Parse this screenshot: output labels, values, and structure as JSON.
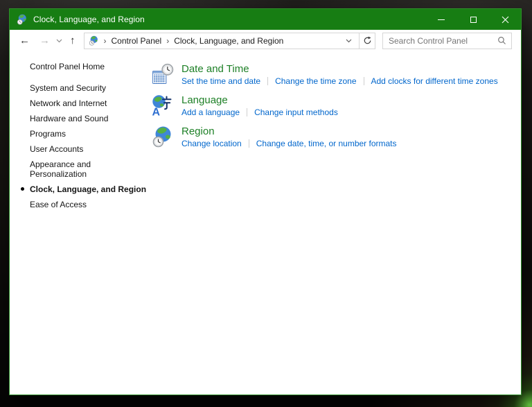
{
  "window": {
    "title": "Clock, Language, and Region"
  },
  "navbar": {
    "icons": {
      "back": "←",
      "forward": "→",
      "up": "↑"
    },
    "breadcrumb": {
      "separator": "›",
      "items": [
        "Control Panel",
        "Clock, Language, and Region"
      ]
    },
    "search": {
      "placeholder": "Search Control Panel"
    }
  },
  "sidebar": {
    "home": "Control Panel Home",
    "items": [
      {
        "label": "System and Security"
      },
      {
        "label": "Network and Internet"
      },
      {
        "label": "Hardware and Sound"
      },
      {
        "label": "Programs"
      },
      {
        "label": "User Accounts"
      },
      {
        "label": "Appearance and Personalization"
      },
      {
        "label": "Clock, Language, and Region",
        "active": true
      },
      {
        "label": "Ease of Access"
      }
    ]
  },
  "main": {
    "sections": [
      {
        "icon": "date-and-time-icon",
        "title": "Date and Time",
        "links": [
          "Set the time and date",
          "Change the time zone",
          "Add clocks for different time zones"
        ]
      },
      {
        "icon": "language-icon",
        "title": "Language",
        "links": [
          "Add a language",
          "Change input methods"
        ]
      },
      {
        "icon": "region-icon",
        "title": "Region",
        "links": [
          "Change location",
          "Change date, time, or number formats"
        ]
      }
    ]
  },
  "colors": {
    "titlebar_green": "#177d13",
    "window_border_green": "#2f8f2b",
    "heading_green": "#1e8027",
    "link_blue": "#0066cc"
  }
}
